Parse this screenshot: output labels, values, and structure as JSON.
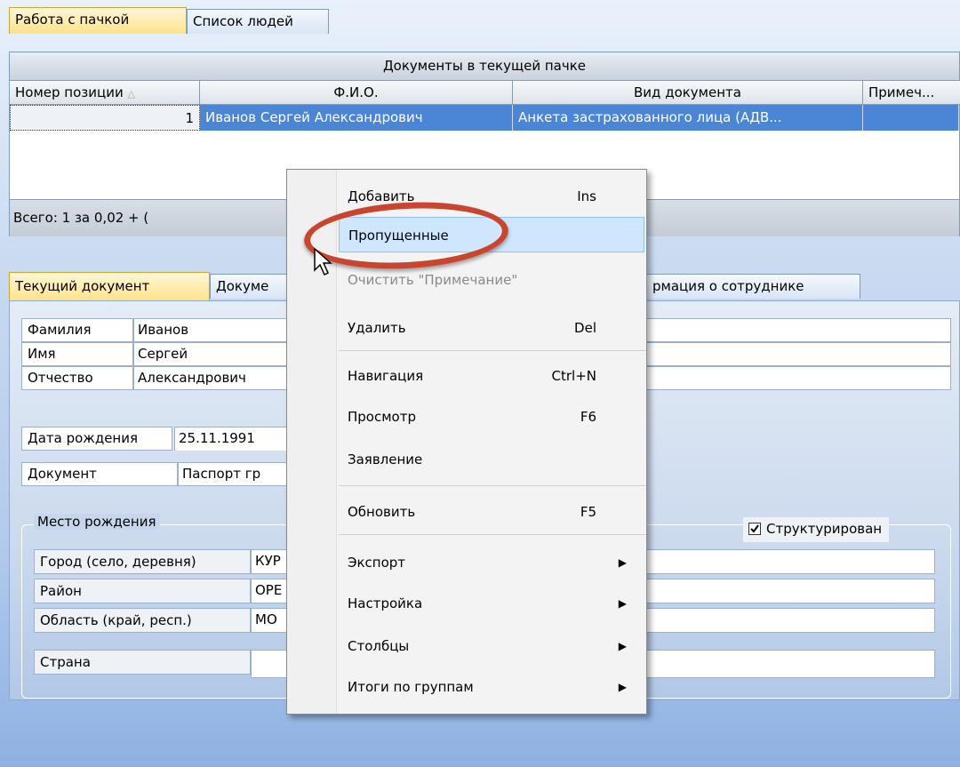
{
  "top_tabs": [
    "Работа с пачкой",
    "Список людей"
  ],
  "grid": {
    "band_title": "Документы в текущей пачке",
    "columns": [
      "Номер позиции",
      "Ф.И.О.",
      "Вид документа",
      "Примеч..."
    ],
    "row": {
      "num": "1",
      "fio": "Иванов Сергей Александрович",
      "doc": "Анкета застрахованного лица (АДВ...",
      "note": ""
    },
    "footer": "Всего: 1 за 0,02 + ("
  },
  "lower_tabs": [
    "Текущий документ",
    "Докуме",
    "рмация о сотруднике"
  ],
  "person": {
    "surname_label": "Фамилия",
    "surname": "Иванов",
    "name_label": "Имя",
    "name": "Сергей",
    "patronymic_label": "Отчество",
    "patronymic": "Александрович",
    "dob_label": "Дата рождения",
    "dob": "25.11.1991",
    "doc_label": "Документ",
    "doc": "Паспорт гр"
  },
  "birthplace": {
    "legend": "Место рождения",
    "structured_label": "Структурирован",
    "structured": true,
    "rows": [
      {
        "label": "Город (село, деревня)",
        "value": "КУР"
      },
      {
        "label": "Район",
        "value": "ОРЕ"
      },
      {
        "label": "Область (край, респ.)",
        "value": "МО"
      },
      {
        "label": "Страна",
        "value": ""
      }
    ]
  },
  "context_menu": {
    "items": [
      {
        "label": "Добавить",
        "shortcut": "Ins"
      },
      {
        "label": "Пропущенные",
        "shortcut": ""
      },
      {
        "label": "Очистить \"Примечание\"",
        "shortcut": ""
      },
      {
        "label": "Удалить",
        "shortcut": "Del"
      },
      {
        "label": "Навигация",
        "shortcut": "Ctrl+N"
      },
      {
        "label": "Просмотр",
        "shortcut": "F6"
      },
      {
        "label": "Заявление",
        "shortcut": ""
      },
      {
        "label": "Обновить",
        "shortcut": "F5"
      },
      {
        "label": "Экспорт",
        "shortcut": ""
      },
      {
        "label": "Настройка",
        "shortcut": ""
      },
      {
        "label": "Столбцы",
        "shortcut": ""
      },
      {
        "label": "Итоги по группам",
        "shortcut": ""
      }
    ]
  },
  "colors": {
    "accent": "#4b85d6",
    "highlight_ring": "#c9452e",
    "active_tab": "#ffe28a"
  }
}
